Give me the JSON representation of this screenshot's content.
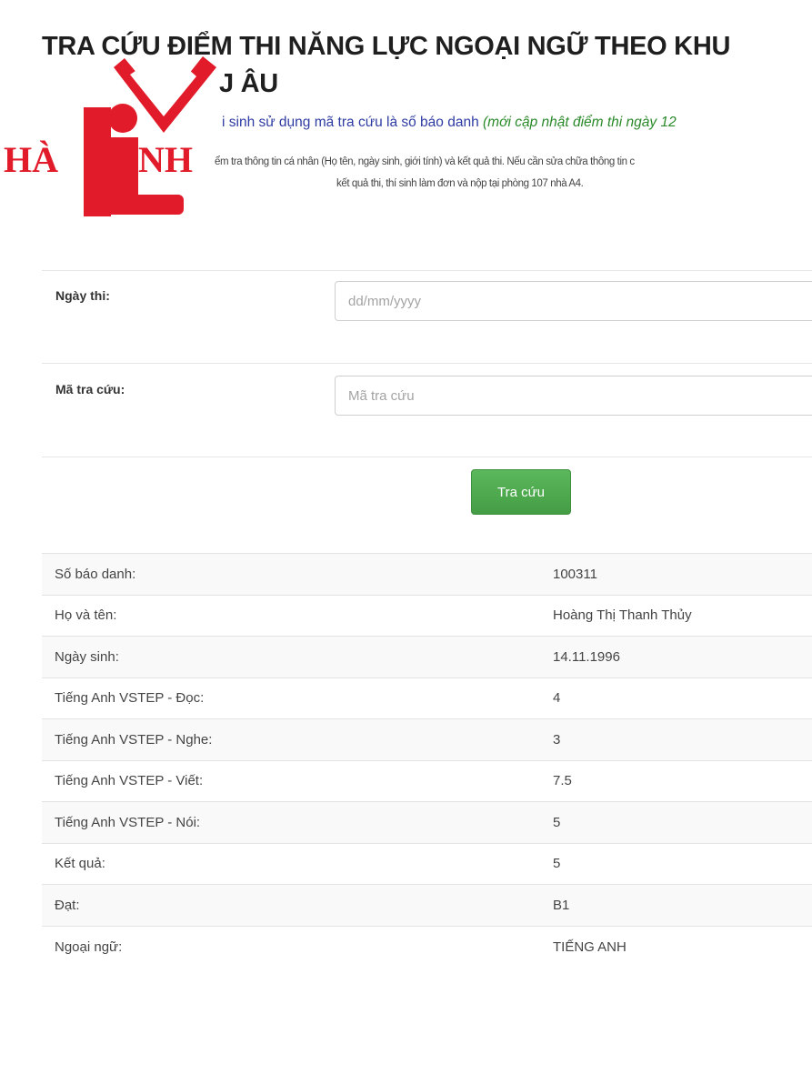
{
  "title": {
    "line1": "TRA CỨU ĐIỂM THI NĂNG LỰC NGOẠI NGỮ THEO KHU",
    "line2": "J ÂU"
  },
  "notes": {
    "lookup_hint": "i sinh sử dụng mã tra cứu là số báo danh ",
    "update_hint": "(mới cập nhật điểm thi ngày 12",
    "check_line1": "ểm tra thông tin cá nhân (Họ tên, ngày sinh, giới tính) và kết quả thi. Nếu cần sửa chữa thông tin c",
    "check_line2": "kết quả thi, thí sinh làm đơn và nộp tại phòng 107 nhà A4."
  },
  "logo": {
    "text": "HÀ LINH",
    "red": "#e21b2a"
  },
  "form": {
    "date_label": "Ngày thi:",
    "date_placeholder": "dd/mm/yyyy",
    "code_label": "Mã tra cứu:",
    "code_placeholder": "Mã tra cứu",
    "submit_label": "Tra cứu"
  },
  "results": [
    {
      "label": "Số báo danh:",
      "value": "100311"
    },
    {
      "label": "Họ và tên:",
      "value": "Hoàng Thị Thanh Thủy"
    },
    {
      "label": "Ngày sinh:",
      "value": "14.11.1996"
    },
    {
      "label": "Tiếng Anh VSTEP - Đọc:",
      "value": "4"
    },
    {
      "label": "Tiếng Anh VSTEP - Nghe:",
      "value": "3"
    },
    {
      "label": "Tiếng Anh VSTEP - Viết:",
      "value": "7.5"
    },
    {
      "label": "Tiếng Anh VSTEP - Nói:",
      "value": "5"
    },
    {
      "label": "Kết quả:",
      "value": "5"
    },
    {
      "label": "Đạt:",
      "value": "B1"
    },
    {
      "label": "Ngoại ngữ:",
      "value": "TIẾNG ANH"
    }
  ],
  "colors": {
    "button_green": "#5cb85c",
    "note_blue": "#2e3ba3",
    "note_green": "#2a8a2a"
  }
}
